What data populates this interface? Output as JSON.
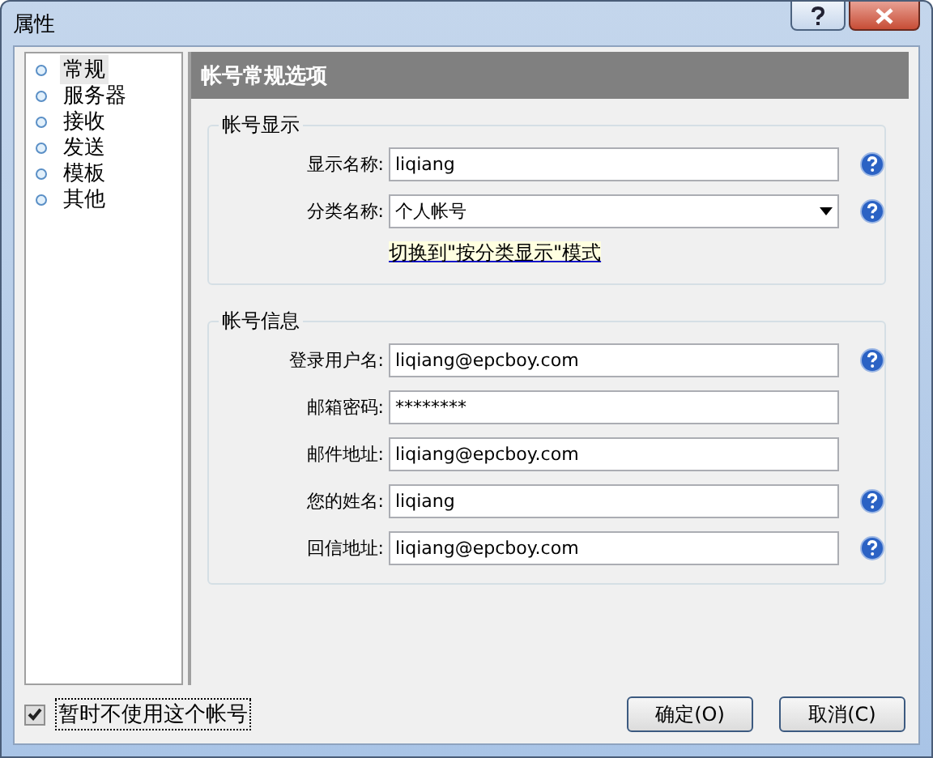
{
  "window": {
    "title": "属性"
  },
  "sidebar": {
    "items": [
      {
        "label": "常规",
        "selected": true
      },
      {
        "label": "服务器",
        "selected": false
      },
      {
        "label": "接收",
        "selected": false
      },
      {
        "label": "发送",
        "selected": false
      },
      {
        "label": "模板",
        "selected": false
      },
      {
        "label": "其他",
        "selected": false
      }
    ]
  },
  "panel": {
    "title": "帐号常规选项",
    "groups": [
      {
        "title": "帐号显示",
        "fields": [
          {
            "label": "显示名称:",
            "kind": "text",
            "value": "liqiang",
            "help": true
          },
          {
            "label": "分类名称:",
            "kind": "select",
            "value": "个人帐号",
            "help": true
          }
        ],
        "link": "切换到\"按分类显示\"模式"
      },
      {
        "title": "帐号信息",
        "fields": [
          {
            "label": "登录用户名:",
            "kind": "text",
            "value": "liqiang@epcboy.com",
            "help": true
          },
          {
            "label": "邮箱密码:",
            "kind": "password",
            "value": "********",
            "help": false
          },
          {
            "label": "邮件地址:",
            "kind": "text",
            "value": "liqiang@epcboy.com",
            "help": false
          },
          {
            "label": "您的姓名:",
            "kind": "text",
            "value": "liqiang",
            "help": true
          },
          {
            "label": "回信地址:",
            "kind": "text",
            "value": "liqiang@epcboy.com",
            "help": true
          }
        ]
      }
    ]
  },
  "footer": {
    "checkbox": {
      "label": "暂时不使用这个帐号",
      "checked": true
    },
    "buttons": [
      "确定(O)",
      "取消(C)"
    ]
  }
}
